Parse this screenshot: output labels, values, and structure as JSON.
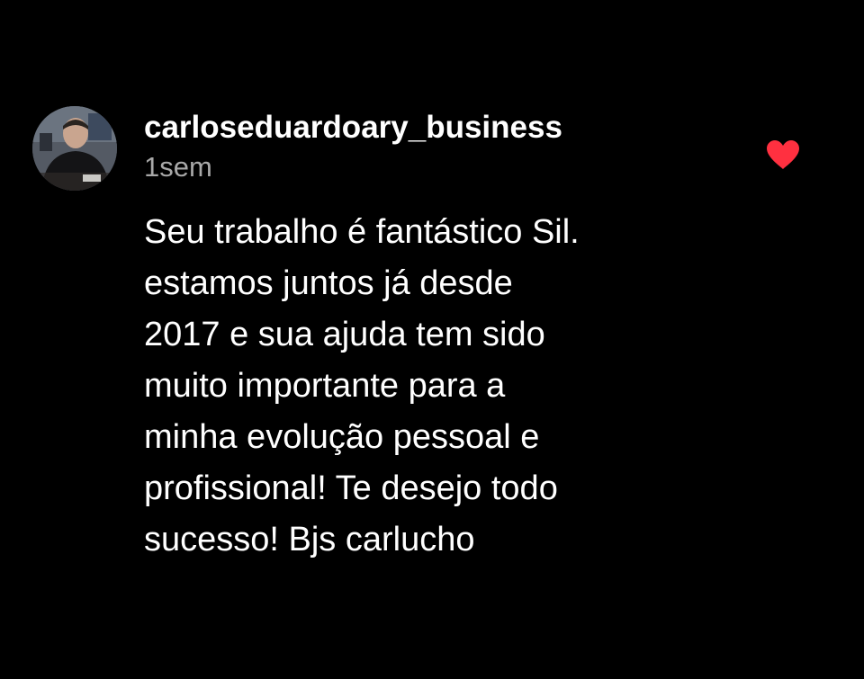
{
  "comment": {
    "username": "carloseduardoary_business",
    "timestamp": "1sem",
    "text_lines": [
      "Seu trabalho é fantástico Sil.",
      "estamos juntos já desde",
      "2017 e sua ajuda tem sido",
      "muito importante para a",
      "minha evolução pessoal e",
      "profissional! Te desejo todo",
      "sucesso! Bjs carlucho"
    ],
    "liked": true,
    "like_icon": "heart-icon",
    "avatar_icon": "profile-photo"
  },
  "colors": {
    "background": "#000000",
    "text": "#ffffff",
    "secondary_text": "#a8a8a8",
    "like": "#ff3040"
  }
}
